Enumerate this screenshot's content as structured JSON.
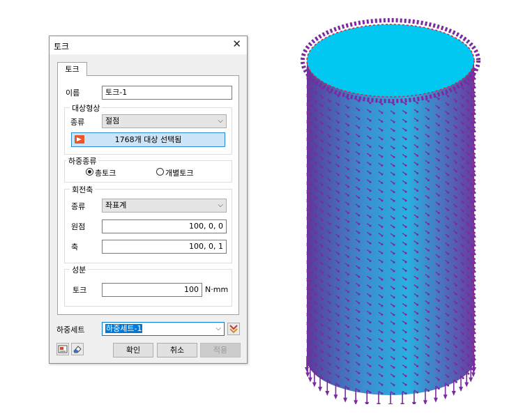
{
  "dialog": {
    "title": "토크",
    "tab_label": "토크",
    "name": {
      "label": "이름",
      "value": "토크-1"
    },
    "target": {
      "group_title": "대상형상",
      "type_label": "종류",
      "type_value": "절점",
      "selection_label": "1768개 대상 선택됨"
    },
    "load_type": {
      "group_title": "하중종류",
      "option_total": "총토크",
      "option_individual": "개별토크",
      "selected": "총토크"
    },
    "rotation_axis": {
      "group_title": "회전축",
      "type_label": "종류",
      "type_value": "좌표계",
      "origin_label": "원점",
      "origin_value": "100, 0, 0",
      "axis_label": "축",
      "axis_value": "100, 0, 1"
    },
    "component": {
      "group_title": "성분",
      "torque_label": "토크",
      "torque_value": "100",
      "unit": "N·mm"
    },
    "load_set": {
      "label": "하중세트",
      "value": "하중세트-1"
    },
    "buttons": {
      "ok": "확인",
      "cancel": "취소",
      "apply": "적용"
    }
  },
  "viewport": {
    "model": "cylinder",
    "top_face_color": "#00c8f0",
    "side_color": "#2aa8d8",
    "arrow_color": "#7a2aa0",
    "edge_color": "#e0203a"
  }
}
